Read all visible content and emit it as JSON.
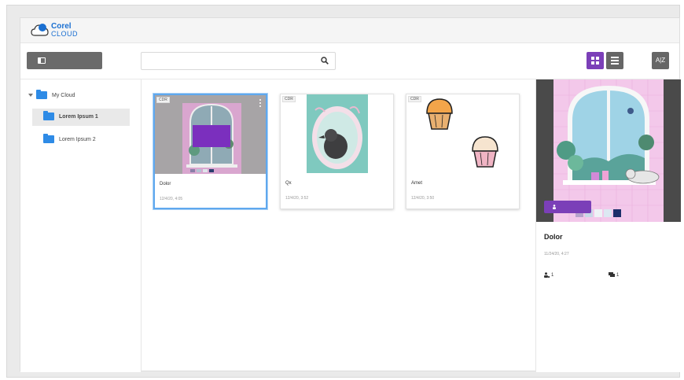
{
  "brand": {
    "name": "Corel",
    "sub": "CLOUD"
  },
  "search": {
    "placeholder": "",
    "value": ""
  },
  "toolbar": {
    "sort_label": "A|Z",
    "active_view": "grid"
  },
  "sidebar": {
    "root": {
      "label": "My Cloud",
      "icon": "folder-icon"
    },
    "items": [
      {
        "label": "Lorem Ipsum 1",
        "selected": true,
        "icon": "folder-icon"
      },
      {
        "label": "Lorem Ipsum 2",
        "selected": false,
        "icon": "folder-icon"
      }
    ]
  },
  "files": [
    {
      "badge": "CDR",
      "name": "Dolor",
      "date": "12/4/20, 4:05",
      "selected": true
    },
    {
      "badge": "CDR",
      "name": "Qx",
      "date": "12/4/20, 3:52",
      "selected": false
    },
    {
      "badge": "CDR",
      "name": "Amet",
      "date": "12/4/20, 3:50",
      "selected": false
    }
  ],
  "detail": {
    "title": "Dolor",
    "date": "11/24/20, 4:27",
    "users": "1",
    "comments": "1"
  },
  "colors": {
    "accent": "#7b3fb8",
    "folder": "#2e8be6",
    "selection": "#5fa8ee"
  }
}
